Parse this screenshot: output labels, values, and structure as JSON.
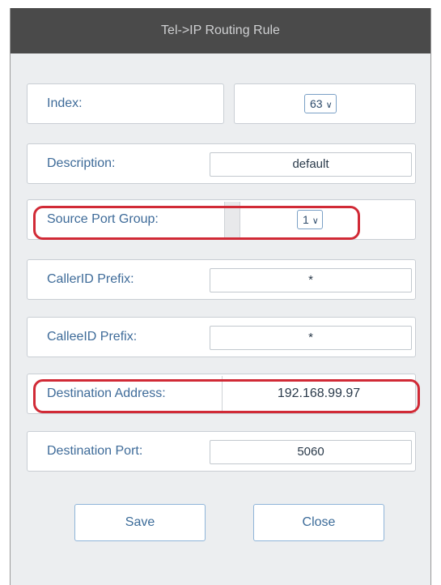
{
  "dialog": {
    "title": "Tel->IP Routing Rule"
  },
  "form": {
    "index": {
      "label": "Index:",
      "value": "63"
    },
    "description": {
      "label": "Description:",
      "value": "default"
    },
    "source_port_group": {
      "label": "Source Port Group:",
      "value": "1"
    },
    "callerid_prefix": {
      "label": "CallerID Prefix:",
      "value": "*"
    },
    "calleeid_prefix": {
      "label": "CalleeID Prefix:",
      "value": "*"
    },
    "destination_address": {
      "label": "Destination Address:",
      "value": "192.168.99.97"
    },
    "destination_port": {
      "label": "Destination Port:",
      "value": "5060"
    }
  },
  "buttons": {
    "save_label": "Save",
    "close_label": "Close"
  },
  "colors": {
    "titlebar": "#4a4a4a",
    "label_text": "#3e6b99",
    "highlight": "#d12a36"
  },
  "icons": {
    "dropdown": "chevron-down-icon"
  }
}
